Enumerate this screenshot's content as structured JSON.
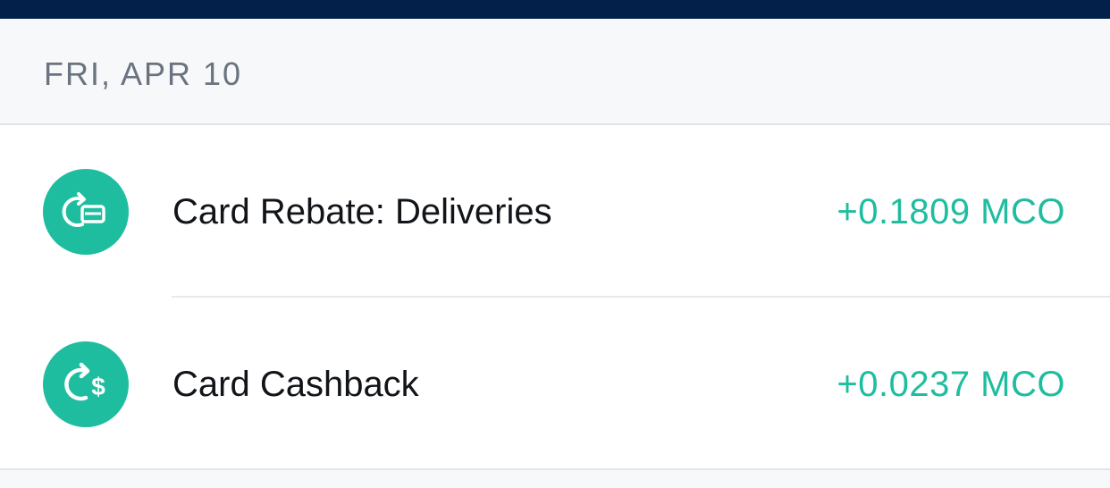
{
  "header": {
    "date": "FRI, APR 10"
  },
  "transactions": [
    {
      "icon": "card-rebate-icon",
      "title": "Card Rebate: Deliveries",
      "amount": "+0.1809 MCO"
    },
    {
      "icon": "cashback-dollar-icon",
      "title": "Card Cashback",
      "amount": "+0.0237 MCO"
    }
  ],
  "colors": {
    "top_bar": "#03204a",
    "accent": "#1fbd9f",
    "header_bg": "#f7f8fa",
    "header_text": "#6a7380",
    "title_text": "#111418"
  }
}
